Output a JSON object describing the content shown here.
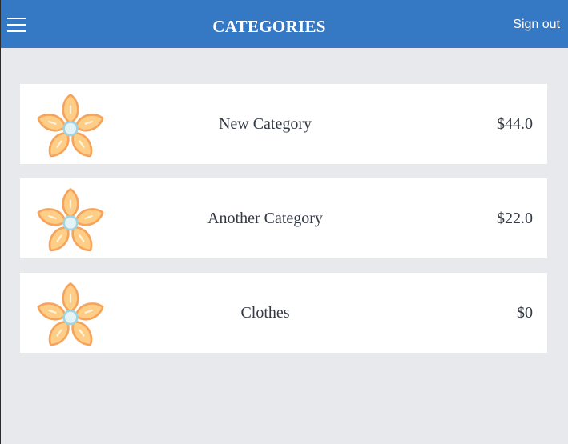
{
  "header": {
    "title": "CATEGORIES",
    "signout_label": "Sign out",
    "menu_icon": "hamburger-menu-icon",
    "background_color": "#3578c4"
  },
  "categories": [
    {
      "name": "New Category",
      "price": "$44.0",
      "icon": "flower-icon"
    },
    {
      "name": "Another Category",
      "price": "$22.0",
      "icon": "flower-icon"
    },
    {
      "name": "Clothes",
      "price": "$0",
      "icon": "flower-icon"
    }
  ]
}
